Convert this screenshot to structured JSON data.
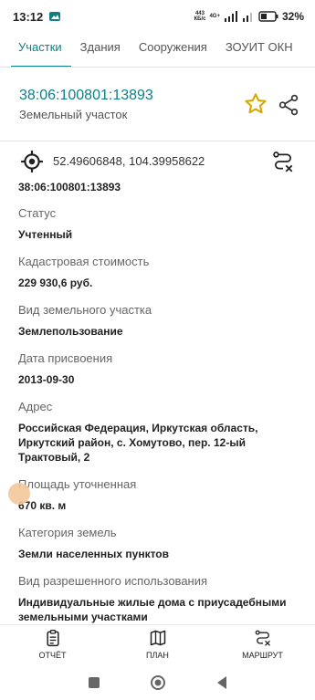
{
  "status_bar": {
    "time": "13:12",
    "net_speed": "443\nКБ/с",
    "network": "4G+",
    "battery": "32%"
  },
  "tabs": [
    {
      "label": "Участки",
      "active": true
    },
    {
      "label": "Здания",
      "active": false
    },
    {
      "label": "Сооружения",
      "active": false
    },
    {
      "label": "ЗОУИТ ОКН",
      "active": false
    }
  ],
  "header": {
    "cadastral_number": "38:06:100801:13893",
    "object_type": "Земельный участок"
  },
  "coords": "52.49606848, 104.39958622",
  "content": {
    "top_number": "38:06:100801:13893",
    "fields": [
      {
        "label": "Статус",
        "value": "Учтенный"
      },
      {
        "label": "Кадастровая стоимость",
        "value": "229 930,6 руб."
      },
      {
        "label": "Вид земельного участка",
        "value": "Землепользование"
      },
      {
        "label": "Дата присвоения",
        "value": "2013-09-30"
      },
      {
        "label": "Адрес",
        "value": "Российская Федерация, Иркутская область, Иркутский район, с. Хомутово, пер. 12-ый Трактовый, 2"
      },
      {
        "label": "Площадь уточненная",
        "value": "670 кв. м"
      },
      {
        "label": "Категория земель",
        "value": "Земли населенных пунктов"
      },
      {
        "label": "Вид разрешенного использования",
        "value": "Индивидуальные жилые дома с приусадебными земельными участками"
      }
    ]
  },
  "bottom_nav": {
    "report": "ОТЧЁТ",
    "plan": "ПЛАН",
    "route": "МАРШРУТ"
  },
  "colors": {
    "accent": "#0e7f86",
    "star": "#d4a900"
  }
}
